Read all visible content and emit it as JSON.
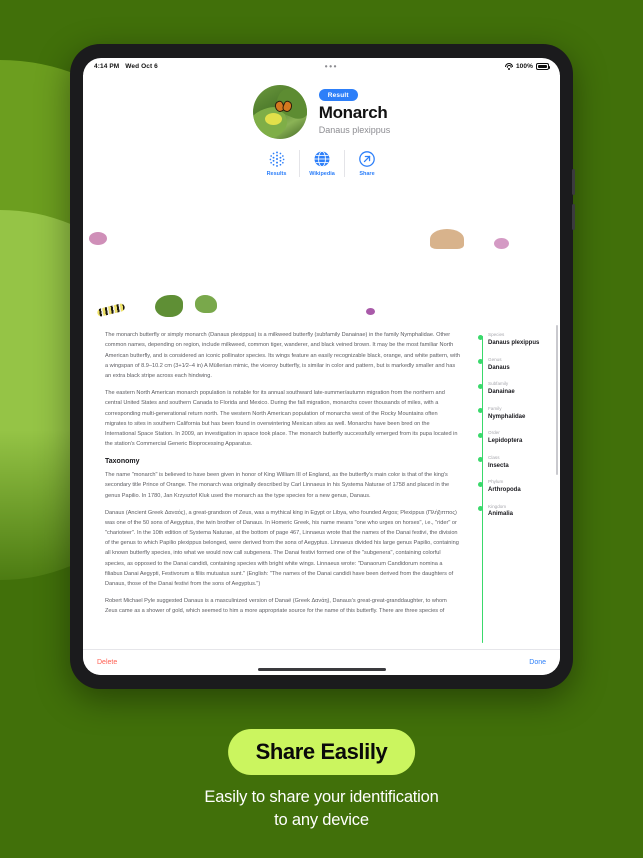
{
  "background": {
    "base_color": "#41700a",
    "blob_mid": "#6c9e1f",
    "blob_light": "#95c446"
  },
  "statusbar": {
    "time": "4:14 PM",
    "date": "Wed Oct 6",
    "center_dots": "•••",
    "battery_percent": "100%",
    "wifi_icon": "wifi-icon",
    "battery_icon": "battery-icon"
  },
  "result_header": {
    "badge": "Result",
    "common_name": "Monarch",
    "scientific_name": "Danaus plexippus",
    "thumbnail_alt": "monarch-butterfly-thumbnail",
    "actions": [
      {
        "label": "Results",
        "icon": "results-dots-icon"
      },
      {
        "label": "Wikipedia",
        "icon": "globe-icon"
      },
      {
        "label": "Share",
        "icon": "share-arrow-icon"
      }
    ]
  },
  "photo_grid": {
    "rows": 2,
    "columns": 7,
    "items": [
      "monarch-on-milkweed-flower",
      "monarch-on-white-flowers",
      "caterpillar-on-leaf-underside",
      "monarch-on-yellow-goldenrod",
      "chrysalises-on-terracotta-pot",
      "monarch-held-in-hand",
      "caterpillar-on-green-leaf",
      "caterpillars-on-milkweed-stems",
      "milkweed-plants-by-brick-path",
      "striped-caterpillar-on-stem",
      "monarch-resting-on-ground",
      "monarch-on-purple-thistle",
      "tiny-larva-on-leaf-surface",
      "chrysalis-hanging-on-wood"
    ]
  },
  "article": {
    "paragraphs": [
      "The monarch butterfly or simply monarch (Danaus plexippus) is a milkweed butterfly (subfamily Danainae) in the family Nymphalidae. Other common names, depending on region, include milkweed, common tiger, wanderer, and black veined brown. It may be the most familiar North American butterfly, and is considered an iconic pollinator species. Its wings feature an easily recognizable black, orange, and white pattern, with a wingspan of 8.9–10.2 cm (3+1⁄2–4 in) A Müllerian mimic, the viceroy butterfly, is similar in color and pattern, but is markedly smaller and has an extra black stripe across each hindwing.",
      "The eastern North American monarch population is notable for its annual southward late-summer/autumn migration from the northern and central United States and southern Canada to Florida and Mexico. During the fall migration, monarchs cover thousands of miles, with a corresponding multi-generational return north. The western North American population of monarchs west of the Rocky Mountains often migrates to sites in southern California but has been found in overwintering Mexican sites as well. Monarchs have been bred on the International Space Station.  In 2009, an investigation in space took place. The monarch butterfly successfully emerged from its pupa located in the station's Commercial Generic Bioprocessing Apparatus."
    ],
    "section_heading": "Taxonomy",
    "taxonomy_paragraphs": [
      "The name \"monarch\" is believed to have been given in honor of King William III of England, as the butterfly's main color is that of the king's secondary title Prince of Orange. The monarch was originally described by Carl Linnaeus in his Systema Naturae of 1758 and placed in the genus Papilio. In 1780, Jan Krzysztof Kluk used the monarch as the type species for a new genus, Danaus.",
      "Danaus (Ancient Greek Δαναός), a great-grandson of Zeus, was a mythical king in Egypt or Libya, who founded Argos; Plexippus (Πλήξιππος) was one of the 50 sons of Aegyptus, the twin brother of Danaus. In Homeric Greek, his name means \"one who urges on horses\", i.e., \"rider\" or \"charioteer\". In the 10th edition of Systema Naturae, at the bottom of page 467, Linnaeus wrote that the names of the Danai festivi, the division of the genus to which Papilio plexippus belonged, were derived from the sons of Aegyptus. Linnaeus divided his large genus Papilio, containing all known butterfly species, into what we would now call subgenera. The Danai festivi formed one of the \"subgenera\", containing colorful species, as opposed to the Danai candidi, containing species with bright white wings. Linnaeus wrote: \"Danaorum Candidorum nomina a filiabus Danai Aegypti, Festivorum a filiis mutuatus sunt.\" (English: \"The names of the Danai candidi have been derived from the daughters of Danaus, those of the Danai festivi from the sons of Aegyptus.\")",
      "Robert Michael Pyle suggested Danaus is a masculinized version of Danaë (Greek Δανάη), Danaus's great-great-granddaughter, to whom Zeus came as a shower of gold, which seemed to him a more appropriate source for the name of this butterfly. There are three species of"
    ]
  },
  "taxonomy_rail": {
    "accent_color": "#3ad96b",
    "entries": [
      {
        "rank": "Species",
        "name": "Danaus plexippus"
      },
      {
        "rank": "Genus",
        "name": "Danaus"
      },
      {
        "rank": "Subfamily",
        "name": "Danainae"
      },
      {
        "rank": "Family",
        "name": "Nymphalidae"
      },
      {
        "rank": "Order",
        "name": "Lepidoptera"
      },
      {
        "rank": "Class",
        "name": "Insecta"
      },
      {
        "rank": "Phylum",
        "name": "Arthropoda"
      },
      {
        "rank": "Kingdom",
        "name": "Animalia"
      }
    ]
  },
  "toolbar": {
    "delete_label": "Delete",
    "done_label": "Done",
    "delete_color": "#ff5f52",
    "done_color": "#2d7ff9"
  },
  "marketing": {
    "pill_text": "Share Easlily",
    "pill_color": "#cbf55f",
    "tagline_line1": "Easily to share your identification",
    "tagline_line2": "to any device"
  }
}
